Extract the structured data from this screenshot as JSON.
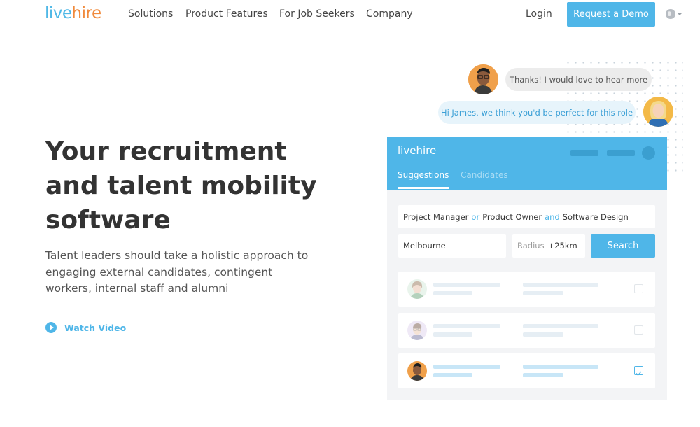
{
  "nav": {
    "logo_left": "live",
    "logo_right": "hire",
    "links": [
      "Solutions",
      "Product Features",
      "For Job Seekers",
      "Company"
    ],
    "login": "Login",
    "demo": "Request a Demo",
    "globe_icon": "globe-icon"
  },
  "hero": {
    "title": "Your recruitment and talent mobility software",
    "subtitle": "Talent leaders should take a holistic approach to engaging external candidates, contingent workers, internal staff and alumni",
    "watch_video": "Watch Video"
  },
  "chat": {
    "message_1": "Thanks! I would love to hear more",
    "message_2": "Hi James, we think you'd be perfect for this role"
  },
  "app": {
    "logo": "livehire",
    "tabs": [
      "Suggestions",
      "Candidates"
    ],
    "query": {
      "t1": "Project Manager",
      "k1": "or",
      "t2": "Product Owner",
      "k2": "and",
      "t3": "Software Design"
    },
    "location": "Melbourne",
    "radius_label": "Radius",
    "radius_value": "+25km",
    "search": "Search",
    "rows": [
      {
        "checked": false,
        "faded": true
      },
      {
        "checked": false,
        "faded": true
      },
      {
        "checked": true,
        "faded": false
      }
    ]
  },
  "colors": {
    "brand_blue": "#4fb6e8",
    "brand_orange": "#f08a3c"
  }
}
